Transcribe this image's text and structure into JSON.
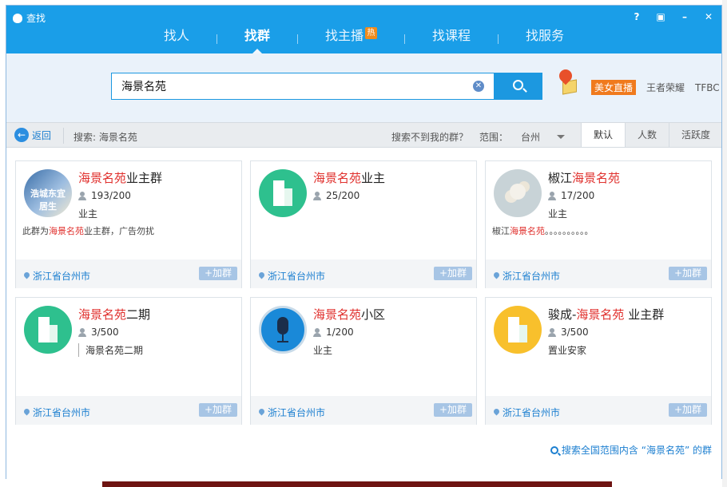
{
  "window": {
    "title": "查找"
  },
  "tabs": [
    {
      "label": "找人"
    },
    {
      "label": "找群"
    },
    {
      "label": "找主播",
      "badge": "热"
    },
    {
      "label": "找课程"
    },
    {
      "label": "找服务"
    }
  ],
  "search": {
    "value": "海景名苑",
    "clear_icon": "clear-icon",
    "button_icon": "search-icon"
  },
  "hot_links": [
    "美女直播",
    "王者荣耀",
    "TFBC"
  ],
  "filter": {
    "back_label": "返回",
    "query_label": "搜索: 海景名苑",
    "not_found_label": "搜索不到我的群？",
    "range_label": "范围：",
    "city": "台州",
    "sort_options": [
      "默认",
      "人数",
      "活跃度"
    ],
    "sort_selected": "默认"
  },
  "groups": [
    {
      "name_hl": "海景名苑",
      "name_rest": "业主群",
      "members": "193/200",
      "tag": "业主",
      "desc_pre": "此群为",
      "desc_hl": "海景名苑",
      "desc_post": "业主群，广告勿扰",
      "location": "浙江省台州市",
      "join_label": "+加群",
      "avatar_text": "浩城东宜居生"
    },
    {
      "name_hl": "海景名苑",
      "name_rest": "业主",
      "members": "25/200",
      "tag": "",
      "desc_pre": "",
      "desc_hl": "",
      "desc_post": "",
      "location": "浙江省台州市",
      "join_label": "+加群"
    },
    {
      "name_pre": "椒江",
      "name_hl": "海景名苑",
      "name_rest": "",
      "members": "17/200",
      "tag": "业主",
      "desc_pre": "椒江",
      "desc_hl": "海景名苑",
      "desc_post": "。。。。。。。。。。",
      "location": "浙江省台州市",
      "join_label": "+加群"
    },
    {
      "name_hl": "海景名苑",
      "name_rest": "二期",
      "members": "3/500",
      "tag": "海景名苑二期",
      "desc_pre": "",
      "desc_hl": "",
      "desc_post": "",
      "location": "浙江省台州市",
      "join_label": "+加群"
    },
    {
      "name_hl": "海景名苑",
      "name_rest": "小区",
      "members": "1/200",
      "tag": "业主",
      "desc_pre": "",
      "desc_hl": "",
      "desc_post": "",
      "location": "浙江省台州市",
      "join_label": "+加群"
    },
    {
      "name_pre": "骏成-",
      "name_hl": "海景名苑",
      "name_rest": " 业主群",
      "members": "3/500",
      "tag": "置业安家",
      "desc_pre": "",
      "desc_hl": "",
      "desc_post": "",
      "location": "浙江省台州市",
      "join_label": "+加群"
    }
  ],
  "footer_search": "搜索全国范围内含 “海景名苑” 的群"
}
